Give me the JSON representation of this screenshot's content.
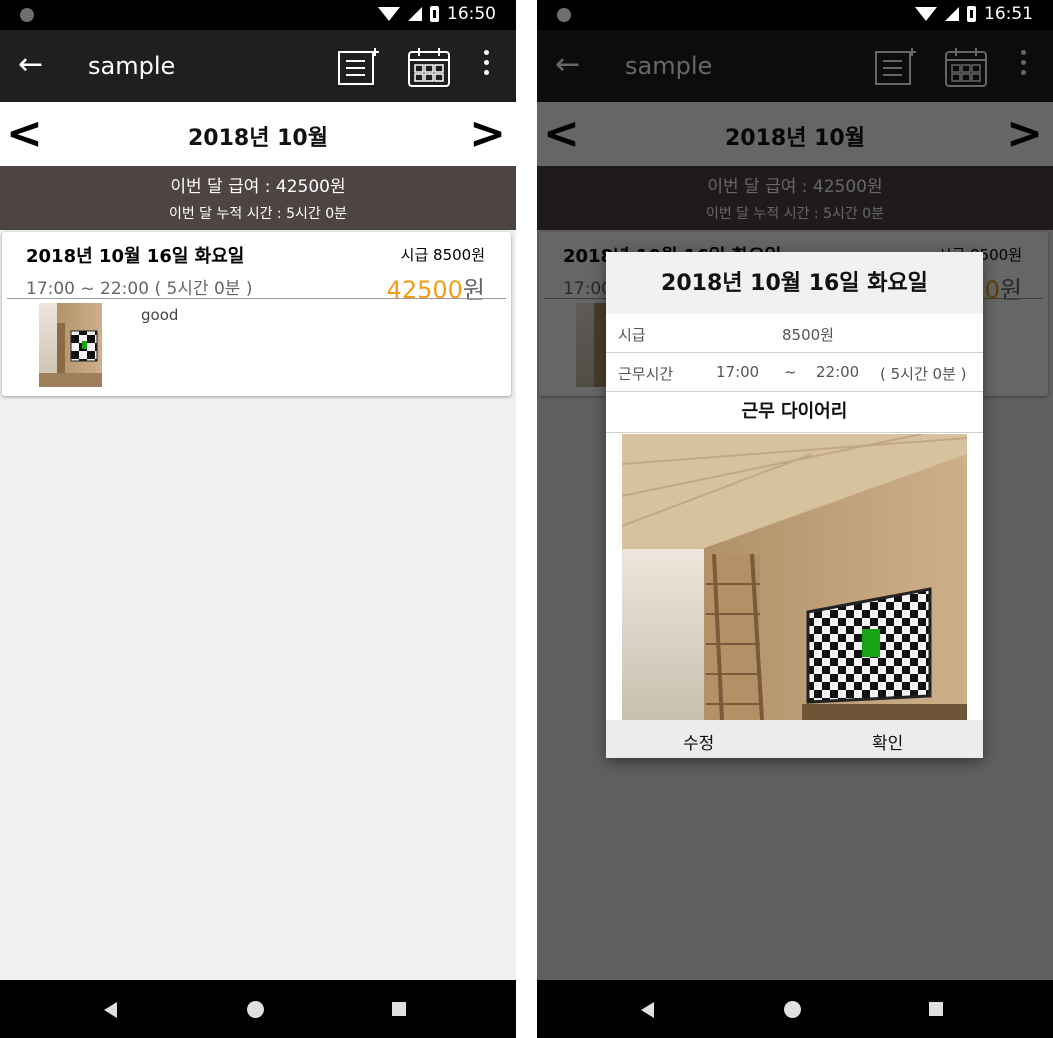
{
  "status_left": {
    "time": "16:50"
  },
  "status_right": {
    "time": "16:51"
  },
  "toolbar": {
    "title": "sample"
  },
  "month": {
    "label": "2018년 10월"
  },
  "summary": {
    "pay_line": "이번 달 급여 : 42500원",
    "hours_line": "이번 달 누적 시간 : 5시간 0분"
  },
  "entry": {
    "date": "2018년 10월 16일 화요일",
    "wage": "시급 8500원",
    "time": "17:00 ~ 22:00 ( 5시간 0분 )",
    "pay_amount": "42500",
    "pay_unit": "원",
    "note": "good"
  },
  "dialog": {
    "title": "2018년 10월 16일 화요일",
    "wage_label": "시급",
    "wage_value": "8500원",
    "time_label": "근무시간",
    "start": "17:00",
    "tilde": "~",
    "end": "22:00",
    "duration": "( 5시간 0분 )",
    "diary_label": "근무 다이어리",
    "edit_button": "수정",
    "confirm_button": "확인"
  }
}
